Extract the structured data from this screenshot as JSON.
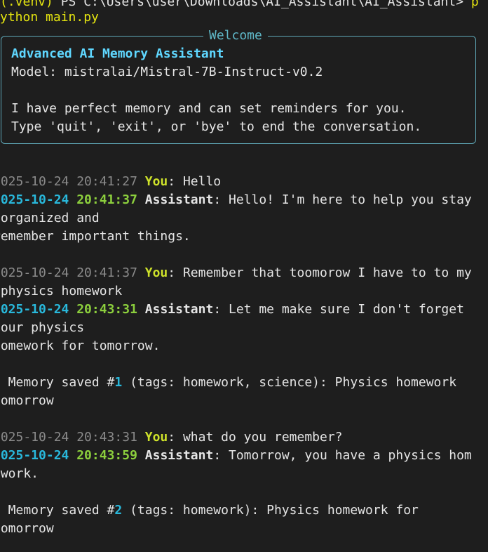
{
  "prompt": {
    "venv": "(.venv)",
    "ps_prefix": " PS C:\\Users\\user\\Downloads\\AI_Assistant\\AI_Assistant> ",
    "cmd_start": "p",
    "cmd_rest": "ython main.py"
  },
  "welcome": {
    "title": "Welcome",
    "heading": "Advanced AI Memory Assistant",
    "model_label": "Model: ",
    "model_value": "mistralai/Mistral-7B-Instruct-v0.2",
    "line1": "I have perfect memory and can set reminders for you.",
    "line2": "Type 'quit', 'exit', or 'bye' to end the conversation."
  },
  "conversation": {
    "msg1_ts": "2025-10-24 20:41:27 ",
    "msg1_speaker": "You",
    "msg1_text": ": Hello",
    "reply1_date": "2025-10-24 ",
    "reply1_time": "20:41:37 ",
    "reply1_speaker": "Assistant",
    "reply1_text_l1": ": Hello! I'm here to help you stay",
    "reply1_text_l2": " organized and",
    "reply1_text_l3": "remember important things.",
    "msg2_ts": "2025-10-24 20:41:37 ",
    "msg2_speaker": "You",
    "msg2_text_l1": ": Remember that toomorow I have to to my",
    "msg2_text_l2": " physics homework",
    "reply2_date": "2025-10-24 ",
    "reply2_time": "20:43:31 ",
    "reply2_speaker": "Assistant",
    "reply2_text_l1": ": Let me make sure I don't forget",
    "reply2_text_l2": "your physics",
    "reply2_text_l3": "homework for tomorrow.",
    "mem1_prefix": "/ Memory saved #",
    "mem1_num": "1",
    "mem1_text_l1": " (tags: homework, science): Physics homework",
    "mem1_text_l2": "tomorrow",
    "msg3_ts": "2025-10-24 20:43:31 ",
    "msg3_speaker": "You",
    "msg3_text": ": what do you remember?",
    "reply3_date": "2025-10-24 ",
    "reply3_time": "20:43:59 ",
    "reply3_speaker": "Assistant",
    "reply3_text_l1": ": Tomorrow, you have a physics hom",
    "reply3_text_l2": "ework.",
    "mem2_prefix": "/ Memory saved #",
    "mem2_num": "2",
    "mem2_text_l1": " (tags: homework): Physics homework for",
    "mem2_text_l2": "tomorrow"
  }
}
